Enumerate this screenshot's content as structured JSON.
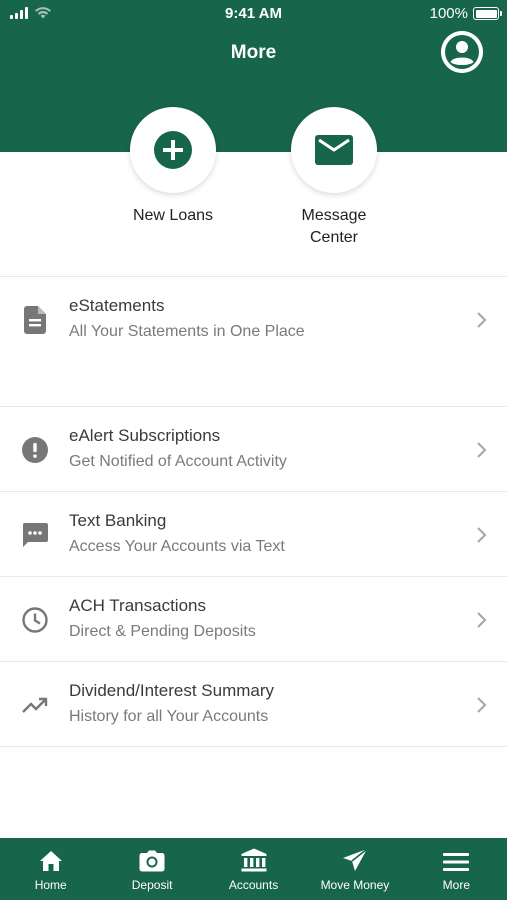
{
  "status": {
    "time": "9:41 AM",
    "battery": "100%"
  },
  "header": {
    "title": "More"
  },
  "quick_actions": [
    {
      "label": "New Loans",
      "icon": "plus-icon"
    },
    {
      "label": "Message Center",
      "label_line1": "Message",
      "label_line2": "Center",
      "icon": "envelope-icon"
    }
  ],
  "section1": [
    {
      "title": "eStatements",
      "subtitle": "All Your Statements in One Place",
      "icon": "document-icon"
    }
  ],
  "section2": [
    {
      "title": "eAlert Subscriptions",
      "subtitle": "Get Notified of Account Activity",
      "icon": "alert-icon"
    },
    {
      "title": "Text Banking",
      "subtitle": "Access Your Accounts via Text",
      "icon": "chat-icon"
    },
    {
      "title": "ACH Transactions",
      "subtitle": "Direct & Pending Deposits",
      "icon": "clock-icon"
    },
    {
      "title": "Dividend/Interest Summary",
      "subtitle": "History for all Your Accounts",
      "icon": "trending-up-icon"
    }
  ],
  "tabs": [
    {
      "label": "Home",
      "icon": "home-icon"
    },
    {
      "label": "Deposit",
      "icon": "camera-icon"
    },
    {
      "label": "Accounts",
      "icon": "bank-icon"
    },
    {
      "label": "Move Money",
      "icon": "send-icon"
    },
    {
      "label": "More",
      "icon": "menu-icon"
    }
  ],
  "colors": {
    "brand_green": "#17654a",
    "icon_gray": "#777777",
    "background": "#ffffff"
  }
}
